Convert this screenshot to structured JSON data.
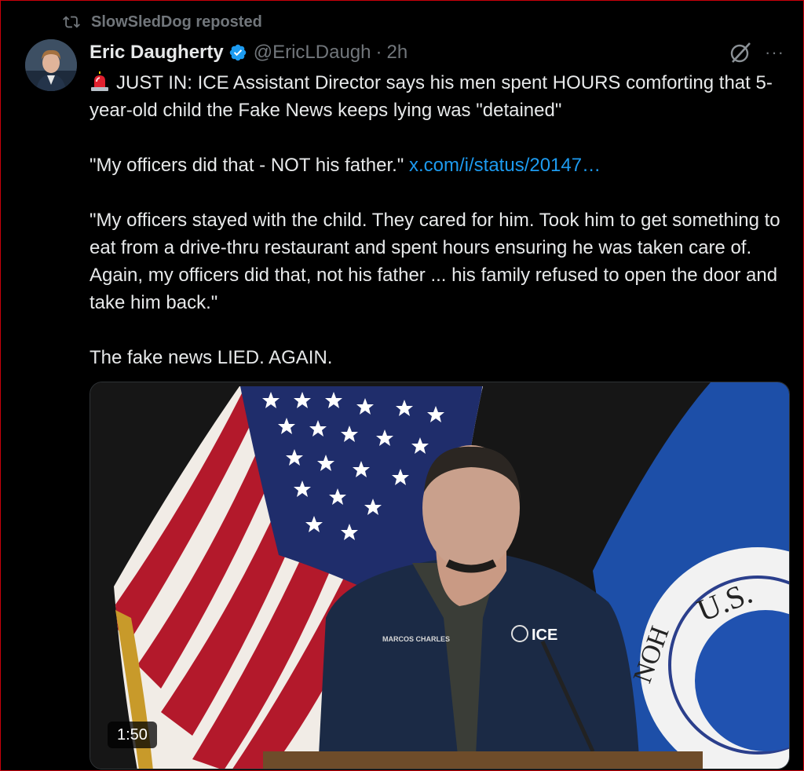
{
  "repost": {
    "label": "SlowSledDog reposted",
    "icon": "repost-icon"
  },
  "author": {
    "name": "Eric Daugherty",
    "handle": "@EricLDaugh",
    "separator": "·",
    "time": "2h",
    "verified": true,
    "verified_color": "#1d9bf0"
  },
  "actions": {
    "grok_icon": "grok-icon",
    "more_icon": "more-icon",
    "more_label": "···"
  },
  "tweet": {
    "line1": "JUST IN: ICE Assistant Director says his men spent HOURS comforting that 5-year-old child the Fake News keeps lying was \"detained\"",
    "quote1": "\"My officers did that - NOT his father.\"",
    "link": "x.com/i/status/20147…",
    "quote2": "\"My officers stayed with the child. They cared for him. Took him to get something to eat from a drive-thru restaurant and spent hours ensuring he was taken care of. Again, my officers did that, not his father ... his family refused to open the door and take him back.\"",
    "closing": "The fake news LIED. AGAIN."
  },
  "media": {
    "type": "video",
    "duration": "1:50",
    "jacket_name": "MARCOS CHARLES",
    "jacket_logo": "ICE",
    "seal_text": "U.S.",
    "seal_partial": "NOH"
  },
  "colors": {
    "background": "#000000",
    "text": "#e7e9ea",
    "secondary": "#71767b",
    "link": "#1d9bf0",
    "frame_border": "#c8000a"
  }
}
